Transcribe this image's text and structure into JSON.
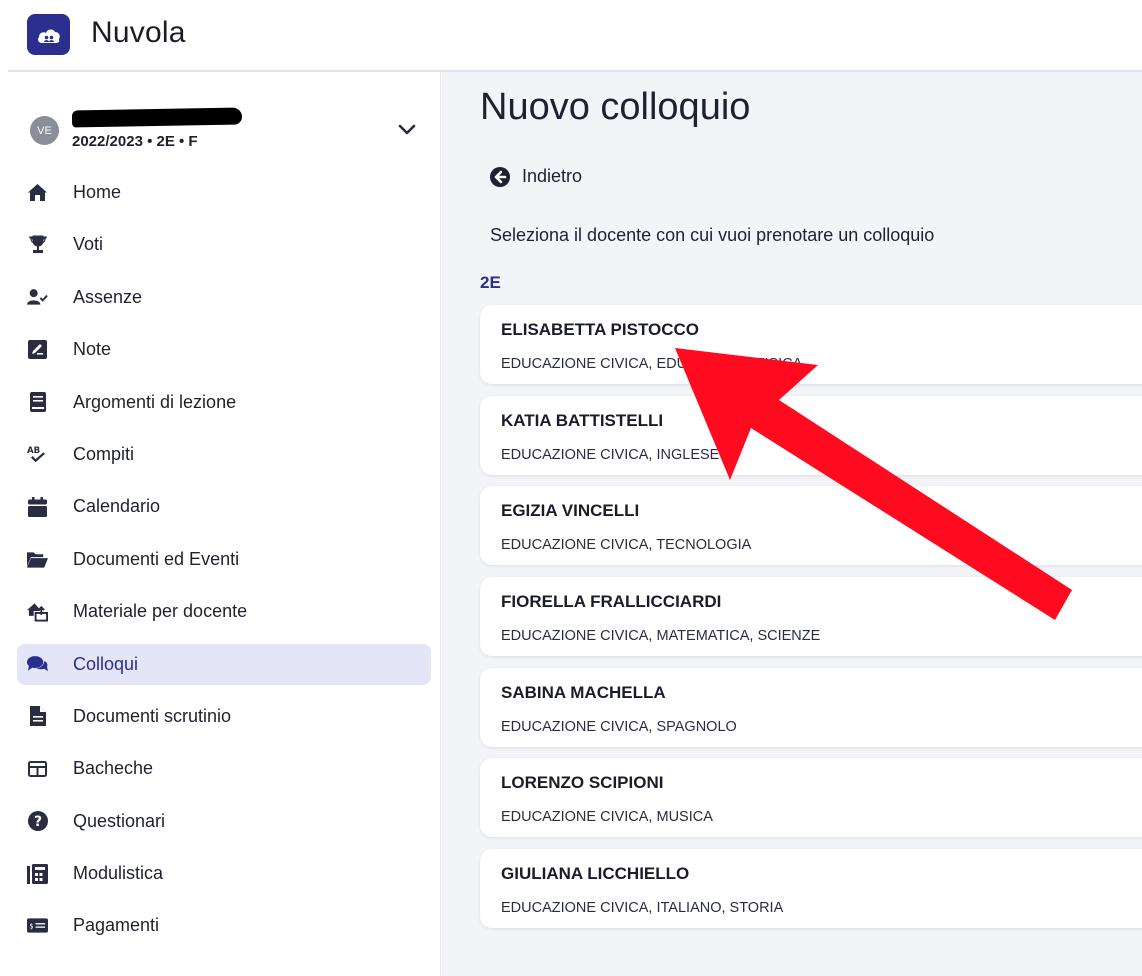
{
  "app": {
    "name": "Nuvola"
  },
  "user": {
    "avatar_initials": "VE",
    "context": "2022/2023 • 2E • F"
  },
  "sidebar": {
    "items": [
      {
        "label": "Home",
        "icon": "home-icon"
      },
      {
        "label": "Voti",
        "icon": "trophy-icon"
      },
      {
        "label": "Assenze",
        "icon": "user-check-icon"
      },
      {
        "label": "Note",
        "icon": "note-edit-icon"
      },
      {
        "label": "Argomenti di lezione",
        "icon": "book-icon"
      },
      {
        "label": "Compiti",
        "icon": "spell-check-icon"
      },
      {
        "label": "Calendario",
        "icon": "calendar-icon"
      },
      {
        "label": "Documenti ed Eventi",
        "icon": "folder-open-icon"
      },
      {
        "label": "Materiale per docente",
        "icon": "house-upload-icon"
      },
      {
        "label": "Colloqui",
        "icon": "comments-icon",
        "active": true
      },
      {
        "label": "Documenti scrutinio",
        "icon": "file-icon"
      },
      {
        "label": "Bacheche",
        "icon": "board-icon"
      },
      {
        "label": "Questionari",
        "icon": "question-circle-icon"
      },
      {
        "label": "Modulistica",
        "icon": "forms-icon"
      },
      {
        "label": "Pagamenti",
        "icon": "money-icon"
      }
    ]
  },
  "main": {
    "title": "Nuovo colloquio",
    "back_label": "Indietro",
    "instruction": "Seleziona il docente con cui vuoi prenotare un colloquio",
    "class_label": "2E",
    "teachers": [
      {
        "name": "ELISABETTA PISTOCCO",
        "subjects": "EDUCAZIONE CIVICA, EDUCAZIONE FISICA"
      },
      {
        "name": "KATIA BATTISTELLI",
        "subjects": "EDUCAZIONE CIVICA, INGLESE"
      },
      {
        "name": "EGIZIA VINCELLI",
        "subjects": "EDUCAZIONE CIVICA, TECNOLOGIA"
      },
      {
        "name": "FIORELLA FRALLICCIARDI",
        "subjects": "EDUCAZIONE CIVICA, MATEMATICA, SCIENZE"
      },
      {
        "name": "SABINA MACHELLA",
        "subjects": "EDUCAZIONE CIVICA, SPAGNOLO"
      },
      {
        "name": "LORENZO SCIPIONI",
        "subjects": "EDUCAZIONE CIVICA, MUSICA"
      },
      {
        "name": "GIULIANA LICCHIELLO",
        "subjects": "EDUCAZIONE CIVICA, ITALIANO, STORIA"
      }
    ]
  },
  "colors": {
    "brand": "#2b2d8f",
    "active_bg": "#e4e5f6",
    "main_bg": "#f3f4f8",
    "annotation_arrow": "#ff0a1e"
  }
}
